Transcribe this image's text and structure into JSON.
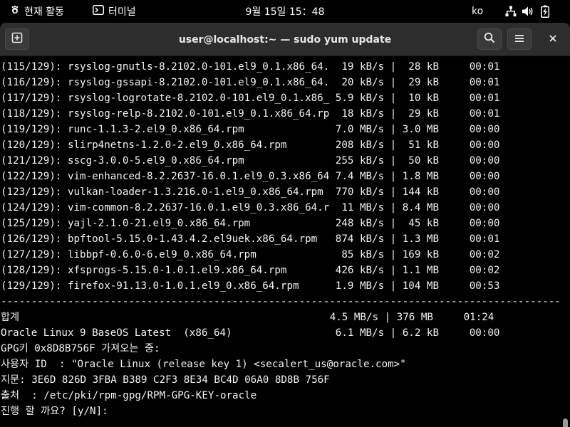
{
  "topbar": {
    "activities_label": "현재 활동",
    "app_label": "터미널",
    "clock": "9월 15일  15：48",
    "input_language": "ko",
    "tray_icons": [
      "network-icon",
      "volume-icon",
      "battery-icon"
    ]
  },
  "window": {
    "title": "user@localhost:~ — sudo yum update",
    "new_tab_icon": "new-tab-icon",
    "search_icon": "search-icon",
    "menu_icon": "hamburger-menu-icon",
    "close_icon": "close-icon"
  },
  "terminal": {
    "lines": [
      "(115/129): rsyslog-gnutls-8.2102.0-101.el9_0.1.x86_64.  19 kB/s |  28 kB     00:01",
      "(116/129): rsyslog-gssapi-8.2102.0-101.el9_0.1.x86_64.  20 kB/s |  29 kB     00:01",
      "(117/129): rsyslog-logrotate-8.2102.0-101.el9_0.1.x86_ 5.9 kB/s |  10 kB     00:01",
      "(118/129): rsyslog-relp-8.2102.0-101.el9_0.1.x86_64.rp  18 kB/s |  29 kB     00:01",
      "(119/129): runc-1.1.3-2.el9_0.x86_64.rpm               7.0 MB/s | 3.0 MB     00:00",
      "(120/129): slirp4netns-1.2.0-2.el9_0.x86_64.rpm        208 kB/s |  51 kB     00:00",
      "(121/129): sscg-3.0.0-5.el9_0.x86_64.rpm               255 kB/s |  50 kB     00:00",
      "(122/129): vim-enhanced-8.2.2637-16.0.1.el9_0.3.x86_64 7.4 MB/s | 1.8 MB     00:00",
      "(123/129): vulkan-loader-1.3.216.0-1.el9_0.x86_64.rpm  770 kB/s | 144 kB     00:00",
      "(124/129): vim-common-8.2.2637-16.0.1.el9_0.3.x86_64.r  11 MB/s | 8.4 MB     00:00",
      "(125/129): yajl-2.1.0-21.el9_0.x86_64.rpm              248 kB/s |  45 kB     00:00",
      "(126/129): bpftool-5.15.0-1.43.4.2.el9uek.x86_64.rpm   874 kB/s | 1.3 MB     00:01",
      "(127/129): libbpf-0.6.0-6.el9_0.x86_64.rpm              85 kB/s | 169 kB     00:02",
      "(128/129): xfsprogs-5.15.0-1.0.1.el9.x86_64.rpm        426 kB/s | 1.1 MB     00:02",
      "(129/129): firefox-91.13.0-1.0.1.el9_0.x86_64.rpm      1.9 MB/s | 104 MB     00:53",
      "--------------------------------------------------------------------------------------------",
      "합계                                                   4.5 MB/s | 376 MB     01:24",
      "Oracle Linux 9 BaseOS Latest  (x86_64)                 6.1 MB/s | 6.2 kB     00:00",
      "GPG키 0x8D8B756F 가져오는 중:",
      "사용자 ID  : \"Oracle Linux (release key 1) <secalert_us@oracle.com>\"",
      "지문: 3E6D 826D 3FBA B389 C2F3 8E34 BC4D 06A0 8D8B 756F",
      "출처  : /etc/pki/rpm-gpg/RPM-GPG-KEY-oracle",
      "진행 할 까요? [y/N]: "
    ]
  }
}
